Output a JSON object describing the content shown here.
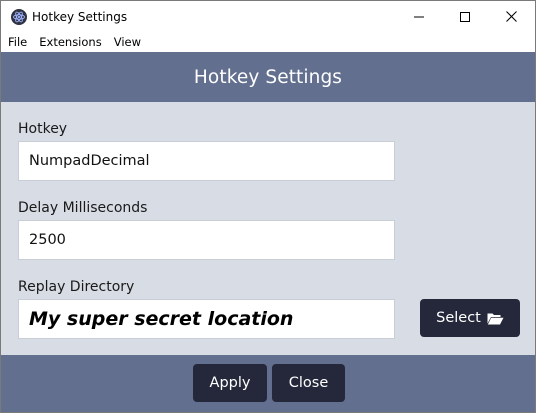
{
  "window": {
    "title": "Hotkey Settings",
    "controls": {
      "minimize_icon": "minimize-icon",
      "maximize_icon": "maximize-icon",
      "close_icon": "close-icon"
    }
  },
  "menu": {
    "items": [
      "File",
      "Extensions",
      "View"
    ]
  },
  "header": {
    "title": "Hotkey Settings"
  },
  "form": {
    "hotkey": {
      "label": "Hotkey",
      "value": "NumpadDecimal"
    },
    "delay": {
      "label": "Delay Milliseconds",
      "value": "2500"
    },
    "replay_directory": {
      "label": "Replay Directory",
      "value": "My super secret location",
      "select_label": "Select",
      "select_icon": "folder-open-icon"
    }
  },
  "footer": {
    "apply_label": "Apply",
    "close_label": "Close"
  },
  "colors": {
    "header_bg": "#626f8f",
    "content_bg": "#d8dce5",
    "button_bg": "#24283a",
    "button_text": "#ffffff"
  }
}
